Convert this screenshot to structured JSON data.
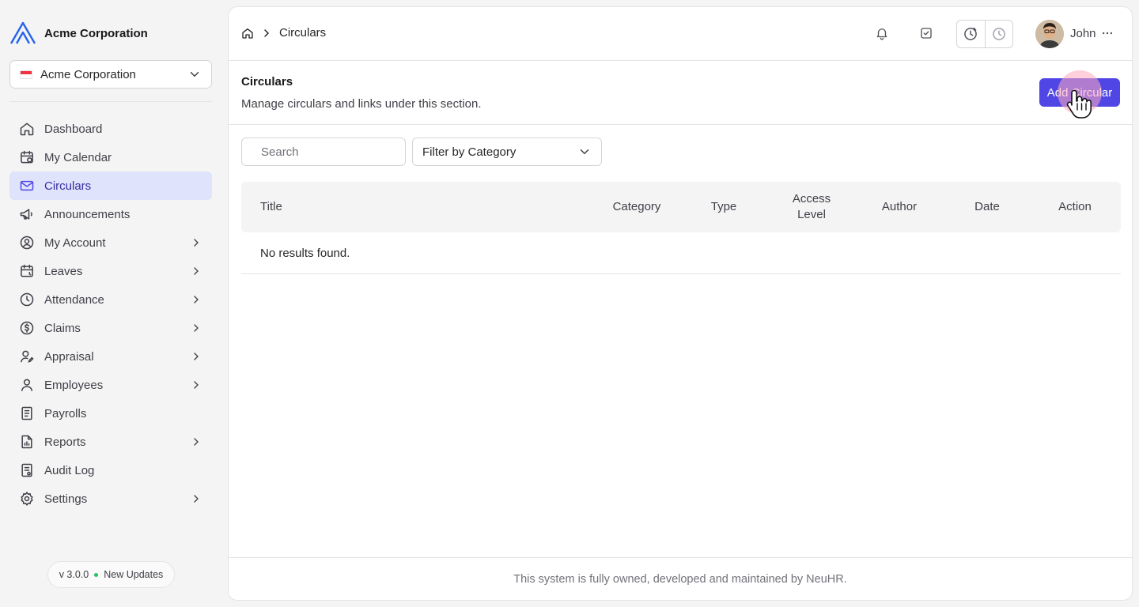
{
  "sidebar": {
    "brand": "Acme Corporation",
    "org_selector": {
      "value": "Acme Corporation",
      "flag": "singapore-flag"
    },
    "items": [
      {
        "label": "Dashboard",
        "icon": "home-icon",
        "has_submenu": false,
        "active": false
      },
      {
        "label": "My Calendar",
        "icon": "calendar-icon",
        "has_submenu": false,
        "active": false
      },
      {
        "label": "Circulars",
        "icon": "mail-icon",
        "has_submenu": false,
        "active": true
      },
      {
        "label": "Announcements",
        "icon": "megaphone-icon",
        "has_submenu": false,
        "active": false
      },
      {
        "label": "My Account",
        "icon": "user-circle-icon",
        "has_submenu": true,
        "active": false
      },
      {
        "label": "Leaves",
        "icon": "calendar-clock-icon",
        "has_submenu": true,
        "active": false
      },
      {
        "label": "Attendance",
        "icon": "clock-icon",
        "has_submenu": true,
        "active": false
      },
      {
        "label": "Claims",
        "icon": "dollar-icon",
        "has_submenu": true,
        "active": false
      },
      {
        "label": "Appraisal",
        "icon": "user-edit-icon",
        "has_submenu": true,
        "active": false
      },
      {
        "label": "Employees",
        "icon": "user-icon",
        "has_submenu": true,
        "active": false
      },
      {
        "label": "Payrolls",
        "icon": "receipt-icon",
        "has_submenu": false,
        "active": false
      },
      {
        "label": "Reports",
        "icon": "report-icon",
        "has_submenu": true,
        "active": false
      },
      {
        "label": "Audit Log",
        "icon": "log-icon",
        "has_submenu": false,
        "active": false
      },
      {
        "label": "Settings",
        "icon": "gear-icon",
        "has_submenu": true,
        "active": false
      }
    ],
    "version": "v 3.0.0",
    "updates": "New Updates"
  },
  "header": {
    "breadcrumb": [
      "Circulars"
    ],
    "user_name": "John"
  },
  "page": {
    "title": "Circulars",
    "subtitle": "Manage circulars and links under this section.",
    "add_button": "Add Circular"
  },
  "filters": {
    "search_placeholder": "Search",
    "search_value": "",
    "category_label": "Filter by Category"
  },
  "table": {
    "columns": [
      "Title",
      "Category",
      "Type",
      "Access Level",
      "Author",
      "Date",
      "Action"
    ],
    "empty_message": "No results found."
  },
  "footer": {
    "text": "This system is fully owned, developed and maintained by NeuHR."
  },
  "colors": {
    "accent": "#4f46e5",
    "active_bg": "#dfe3fc",
    "brand_logo": "#2563eb"
  }
}
